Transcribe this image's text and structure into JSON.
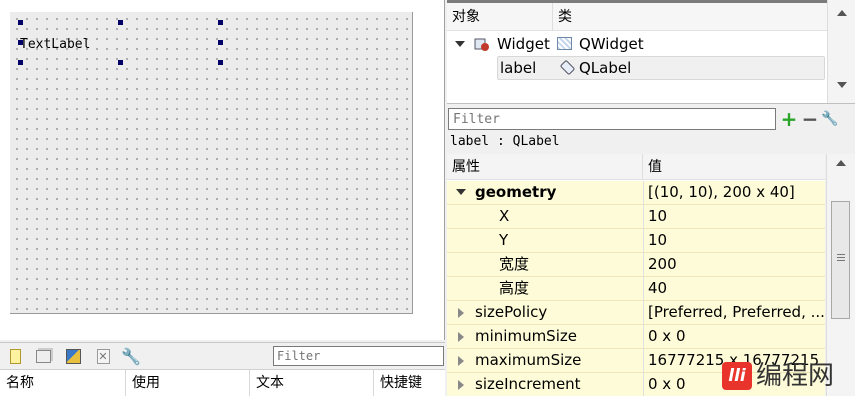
{
  "canvas": {
    "label_text": "TextLabel"
  },
  "action_editor": {
    "filter_placeholder": "Filter",
    "columns": [
      "名称",
      "使用",
      "文本",
      "快捷键"
    ],
    "toolbar_icons": [
      "new-action-icon",
      "open-icon",
      "image-icon",
      "delete-icon",
      "wrench-icon"
    ]
  },
  "object_inspector": {
    "columns": [
      "对象",
      "类"
    ],
    "rows": [
      {
        "object": "Widget",
        "class": "QWidget",
        "expanded": true
      },
      {
        "object": "label",
        "class": "QLabel",
        "selected": true
      }
    ]
  },
  "property_editor": {
    "filter_placeholder": "Filter",
    "object_label": "label : QLabel",
    "columns": [
      "属性",
      "值"
    ],
    "rows": [
      {
        "name": "geometry",
        "value": "[(10, 10), 200 x 40]",
        "bold": true,
        "expanded": true
      },
      {
        "name": "X",
        "value": "10"
      },
      {
        "name": "Y",
        "value": "10"
      },
      {
        "name": "宽度",
        "value": "200"
      },
      {
        "name": "高度",
        "value": "40"
      },
      {
        "name": "sizePolicy",
        "value": "[Preferred, Preferred, ..."
      },
      {
        "name": "minimumSize",
        "value": "0 x 0"
      },
      {
        "name": "maximumSize",
        "value": "16777215 x 16777215"
      },
      {
        "name": "sizeIncrement",
        "value": "0 x 0"
      }
    ],
    "add_icon": "plus-icon",
    "remove_icon": "minus-icon",
    "configure_icon": "wrench-icon"
  },
  "watermark": {
    "logo_text": "lli",
    "text": "编程网"
  },
  "colors": {
    "property_highlight": "#fefcd8",
    "selection_handle": "#000066",
    "add_green": "#2aa52a"
  }
}
